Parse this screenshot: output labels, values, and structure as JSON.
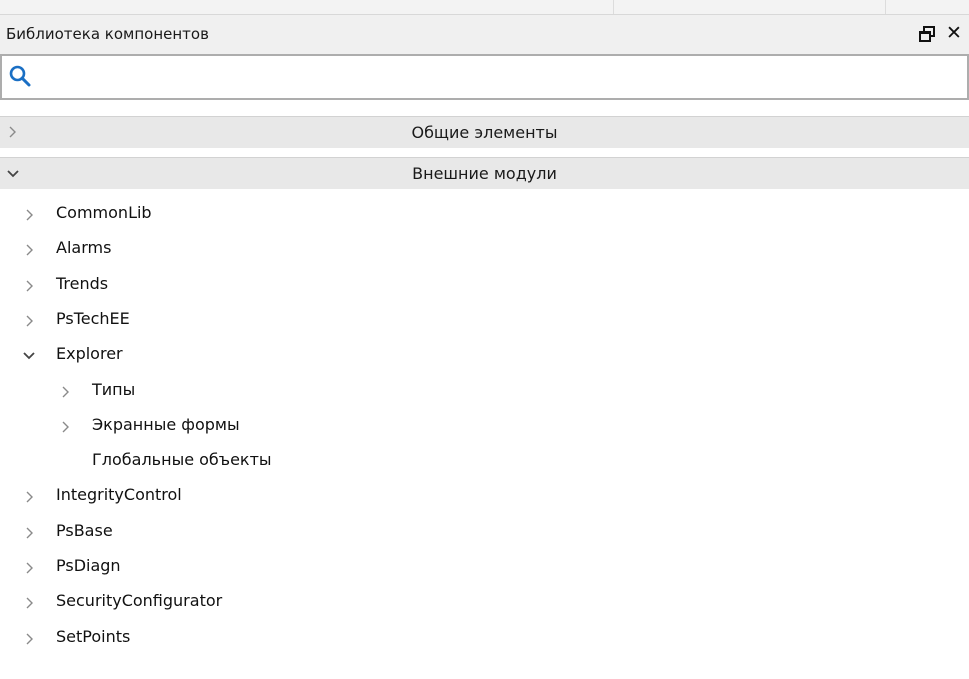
{
  "panel": {
    "title": "Библиотека компонентов",
    "float_icon": "float-window-icon",
    "close_icon": "close-icon",
    "close_glyph": "✕"
  },
  "search": {
    "icon": "search-icon",
    "value": "",
    "placeholder": ""
  },
  "groups": [
    {
      "label": "Общие элементы",
      "expanded": false
    },
    {
      "label": "Внешние модули",
      "expanded": true
    }
  ],
  "tree": [
    {
      "label": "CommonLib",
      "expanded": false,
      "has_children": true,
      "level": 0
    },
    {
      "label": "Alarms",
      "expanded": false,
      "has_children": true,
      "level": 0
    },
    {
      "label": "Trends",
      "expanded": false,
      "has_children": true,
      "level": 0
    },
    {
      "label": "PsTechEE",
      "expanded": false,
      "has_children": true,
      "level": 0
    },
    {
      "label": "Explorer",
      "expanded": true,
      "has_children": true,
      "level": 0
    },
    {
      "label": "Типы",
      "expanded": false,
      "has_children": true,
      "level": 1
    },
    {
      "label": "Экранные формы",
      "expanded": false,
      "has_children": true,
      "level": 1
    },
    {
      "label": "Глобальные объекты",
      "expanded": false,
      "has_children": false,
      "level": 1
    },
    {
      "label": "IntegrityControl",
      "expanded": false,
      "has_children": true,
      "level": 0
    },
    {
      "label": "PsBase",
      "expanded": false,
      "has_children": true,
      "level": 0
    },
    {
      "label": "PsDiagn",
      "expanded": false,
      "has_children": true,
      "level": 0
    },
    {
      "label": "SecurityConfigurator",
      "expanded": false,
      "has_children": true,
      "level": 0
    },
    {
      "label": "SetPoints",
      "expanded": false,
      "has_children": true,
      "level": 0
    }
  ],
  "colors": {
    "search_icon": "#1a6fc4",
    "arrow": "#707070",
    "group_header_bg": "#e8e8e8",
    "titlebar_bg": "#f0f0f0"
  }
}
